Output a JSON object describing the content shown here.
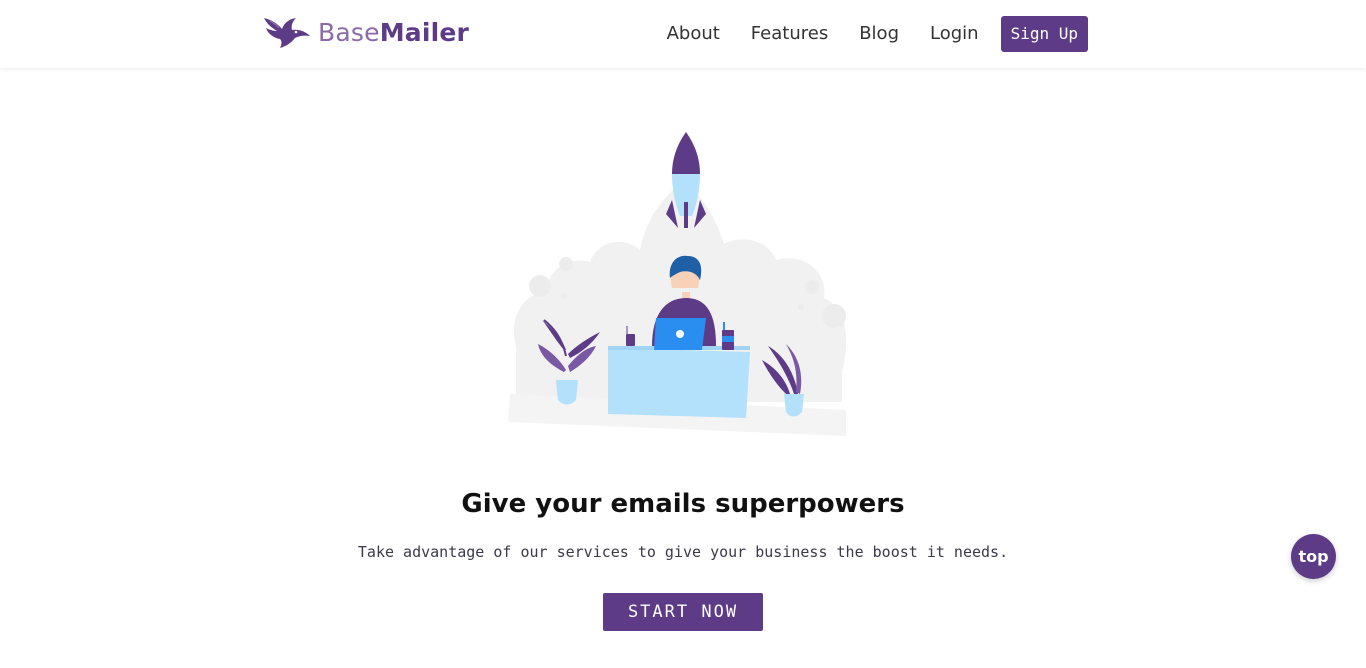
{
  "brand": {
    "name_part1": "Base",
    "name_part2": "Mailer",
    "logo_icon": "eagle-icon"
  },
  "nav": {
    "items": [
      {
        "label": "About"
      },
      {
        "label": "Features"
      },
      {
        "label": "Blog"
      },
      {
        "label": "Login"
      }
    ],
    "signup_label": "Sign Up"
  },
  "hero": {
    "illustration": "rocket-launch-illustration",
    "title": "Give your emails superpowers",
    "subtitle": "Take advantage of our services to give your business the boost it needs.",
    "cta_label": "START NOW"
  },
  "scroll_top": {
    "label": "top"
  },
  "colors": {
    "primary": "#5e3b87",
    "accent_light": "#b3e0fb",
    "cloud": "#f1f1f1"
  }
}
